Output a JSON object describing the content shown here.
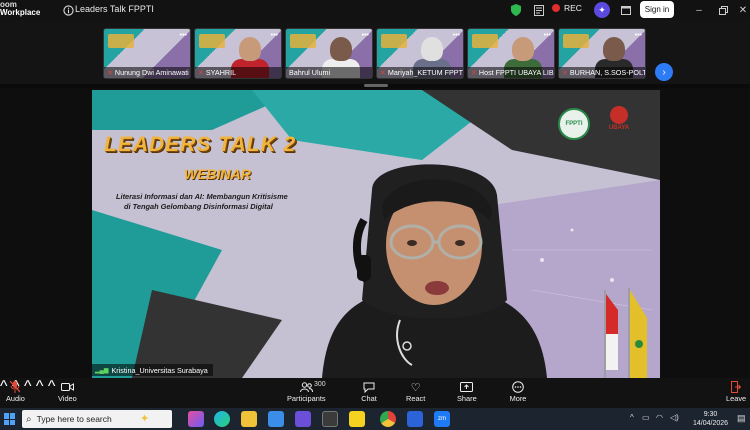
{
  "app": {
    "brand_line1": "oom",
    "brand_line2": "Workplace"
  },
  "meeting": {
    "title": "Leaders Talk FPPTI",
    "rec_label": "REC",
    "signin_label": "Sign in"
  },
  "gallery": {
    "tiles": [
      {
        "name": "Nunung Dwi Aminawati",
        "muted": true
      },
      {
        "name": "SYAHRIL",
        "muted": true
      },
      {
        "name": "Bahrul Ulumi",
        "muted": false
      },
      {
        "name": "Mariyah_KETUM FPPTI",
        "muted": true
      },
      {
        "name": "Host FPPTI UBAYA LIB",
        "muted": true
      },
      {
        "name": "BURHAN, S.SOS-POLTEK",
        "muted": true
      }
    ],
    "next_icon": "chevron-right-icon"
  },
  "stage": {
    "slide_title": "LEADERS TALK 2",
    "slide_subtitle_kind": "WEBINAR",
    "slide_topic_line1": "Literasi Informasi dan AI: Membangun Kritisisme",
    "slide_topic_line2": "di Tengah Gelombang Disinformasi Digital",
    "logo_left_text": "FPPTI",
    "logo_right_text": "UBAYA",
    "speaker_name": "Kristina_Universitas Surabaya"
  },
  "toolbar": {
    "audio": "Audio",
    "video": "Video",
    "participants": "Participants",
    "participants_count": "300",
    "chat": "Chat",
    "react": "React",
    "share": "Share",
    "more": "More",
    "leave": "Leave"
  },
  "taskbar": {
    "search_placeholder": "Type here to search",
    "time": "9:30",
    "date": "14/04/2026"
  },
  "colors": {
    "accent_teal": "#23a3a1",
    "slide_gold": "#f1b43c",
    "record_red": "#e02d2d",
    "zoom_blue": "#2d7cf6"
  }
}
